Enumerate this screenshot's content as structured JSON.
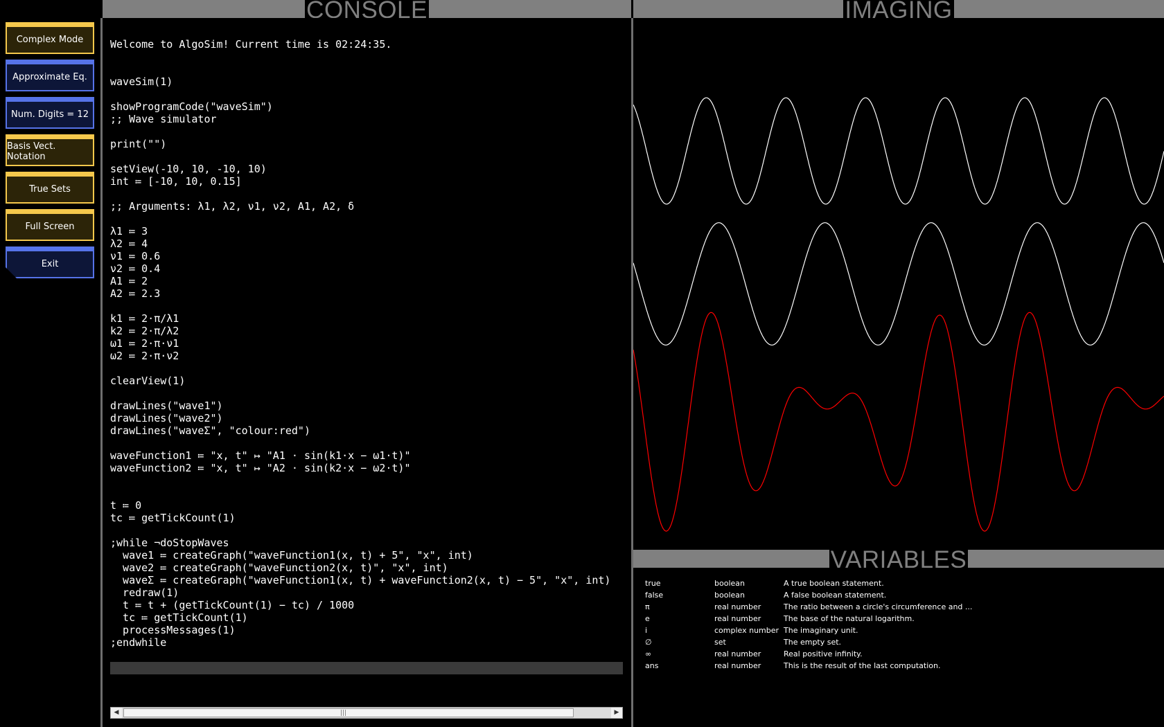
{
  "sidebar": {
    "buttons": [
      {
        "label": "Complex Mode",
        "color": "yellow"
      },
      {
        "label": "Approximate Eq.",
        "color": "blue"
      },
      {
        "label": "Num. Digits = 12",
        "color": "blue"
      },
      {
        "label": "Basis Vect. Notation",
        "color": "yellow"
      },
      {
        "label": "True Sets",
        "color": "yellow"
      },
      {
        "label": "Full Screen",
        "color": "yellow"
      },
      {
        "label": "Exit",
        "color": "blue"
      }
    ]
  },
  "headers": {
    "console": "CONSOLE",
    "imaging": "IMAGING",
    "variables": "VARIABLES"
  },
  "console": {
    "lines": [
      "Welcome to AlgoSim! Current time is 02:24:35.",
      "",
      "",
      "waveSim(1)",
      "",
      "showProgramCode(\"waveSim\")",
      ";; Wave simulator",
      "",
      "print(\"\")",
      "",
      "setView(-10, 10, -10, 10)",
      "int ≔ [-10, 10, 0.15]",
      "",
      ";; Arguments: λ1, λ2, ν1, ν2, A1, A2, δ",
      "",
      "λ1 ≔ 3",
      "λ2 ≔ 4",
      "ν1 ≔ 0.6",
      "ν2 ≔ 0.4",
      "A1 ≔ 2",
      "A2 ≔ 2.3",
      "",
      "k1 ≔ 2⋅π/λ1",
      "k2 ≔ 2⋅π/λ2",
      "ω1 ≔ 2⋅π⋅ν1",
      "ω2 ≔ 2⋅π⋅ν2",
      "",
      "clearView(1)",
      "",
      "drawLines(\"wave1\")",
      "drawLines(\"wave2\")",
      "drawLines(\"waveΣ\", \"colour:red\")",
      "",
      "waveFunction1 ≔ \"x, t\" ↦ \"A1 ⋅ sin(k1⋅x − ω1⋅t)\"",
      "waveFunction2 ≔ \"x, t\" ↦ \"A2 ⋅ sin(k2⋅x − ω2⋅t)\"",
      "",
      "",
      "t ≔ 0",
      "tc ≔ getTickCount(1)",
      "",
      ";while ¬doStopWaves",
      "  wave1 ≔ createGraph(\"waveFunction1(x, t) + 5\", \"x\", int)",
      "  wave2 ≔ createGraph(\"waveFunction2(x, t)\", \"x\", int)",
      "  waveΣ ≔ createGraph(\"waveFunction1(x, t) + waveFunction2(x, t) − 5\", \"x\", int)",
      "  redraw(1)",
      "  t ≔ t + (getTickCount(1) − tc) / 1000",
      "  tc ≔ getTickCount(1)",
      "  processMessages(1)",
      ";endwhile"
    ],
    "input_value": ""
  },
  "imaging": {
    "view": {
      "xmin": -10,
      "xmax": 10,
      "ymin": -10,
      "ymax": 10
    },
    "lambda1": 3,
    "lambda2": 4,
    "A1": 2,
    "A2": 2.3,
    "curves": [
      {
        "name": "wave1",
        "color": "#ffffff"
      },
      {
        "name": "wave2",
        "color": "#ffffff"
      },
      {
        "name": "waveΣ",
        "color": "#ff0000"
      }
    ]
  },
  "variables": [
    {
      "name": "true",
      "type": "boolean",
      "description": "A true boolean statement."
    },
    {
      "name": "false",
      "type": "boolean",
      "description": "A false boolean statement."
    },
    {
      "name": "π",
      "type": "real number",
      "description": "The ratio between a circle's circumference and ..."
    },
    {
      "name": "e",
      "type": "real number",
      "description": "The base of the natural logarithm."
    },
    {
      "name": "i",
      "type": "complex number",
      "description": "The imaginary unit."
    },
    {
      "name": "∅",
      "type": "set",
      "description": "The empty set."
    },
    {
      "name": "∞",
      "type": "real number",
      "description": "Real positive infinity."
    },
    {
      "name": "ans",
      "type": "real number",
      "description": "This is the result of the last computation."
    }
  ]
}
